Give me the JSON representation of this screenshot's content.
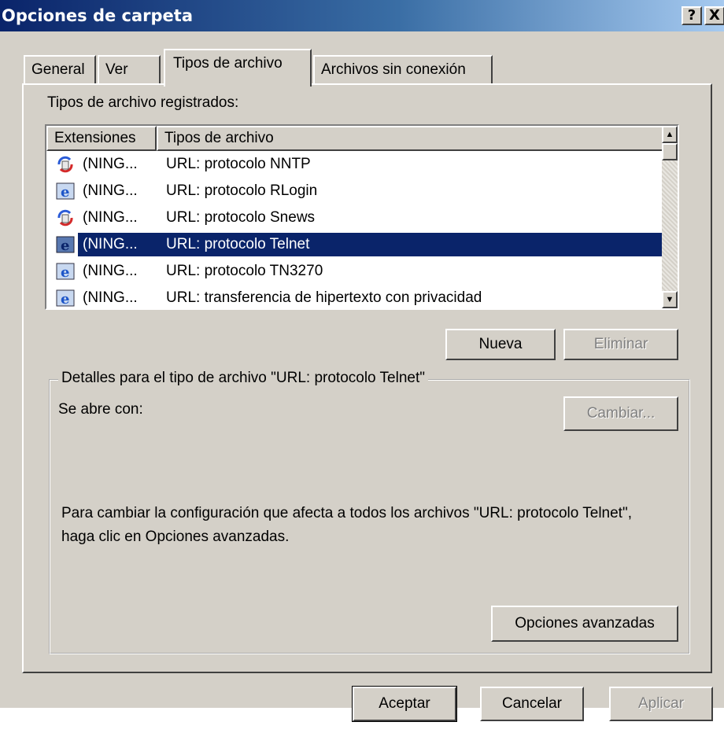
{
  "window": {
    "title": "Opciones de carpeta",
    "help_glyph": "?",
    "close_glyph": "X"
  },
  "tabs": [
    {
      "label": "General"
    },
    {
      "label": "Ver"
    },
    {
      "label": "Tipos de archivo",
      "active": true
    },
    {
      "label": "Archivos sin conexión"
    }
  ],
  "registered_label": "Tipos de archivo registrados:",
  "list": {
    "columns": [
      "Extensiones",
      "Tipos de archivo"
    ],
    "rows": [
      {
        "ext": "(NING...",
        "type": "URL: protocolo NNTP",
        "icon": "news-icon",
        "selected": false
      },
      {
        "ext": "(NING...",
        "type": "URL: protocolo RLogin",
        "icon": "ie-icon",
        "selected": false
      },
      {
        "ext": "(NING...",
        "type": "URL: protocolo Snews",
        "icon": "news-icon",
        "selected": false
      },
      {
        "ext": "(NING...",
        "type": "URL: protocolo Telnet",
        "icon": "ie-icon",
        "selected": true
      },
      {
        "ext": "(NING...",
        "type": "URL: protocolo TN3270",
        "icon": "ie-icon",
        "selected": false
      },
      {
        "ext": "(NING...",
        "type": "URL: transferencia de hipertexto con privacidad",
        "icon": "ie-icon",
        "selected": false
      }
    ]
  },
  "buttons": {
    "nueva": "Nueva",
    "eliminar": "Eliminar",
    "cambiar": "Cambiar...",
    "avanzadas": "Opciones avanzadas",
    "aceptar": "Aceptar",
    "cancelar": "Cancelar",
    "aplicar": "Aplicar"
  },
  "details": {
    "legend": "Detalles para el tipo de archivo \"URL: protocolo Telnet\"",
    "opens_with": "Se abre con:",
    "description": "Para cambiar la configuración que afecta a todos los archivos \"URL: protocolo Telnet\", haga clic en Opciones avanzadas."
  },
  "colors": {
    "title_start": "#0a246a",
    "title_end": "#a6caf0",
    "face": "#d4d0c8",
    "selection": "#0a246a"
  }
}
